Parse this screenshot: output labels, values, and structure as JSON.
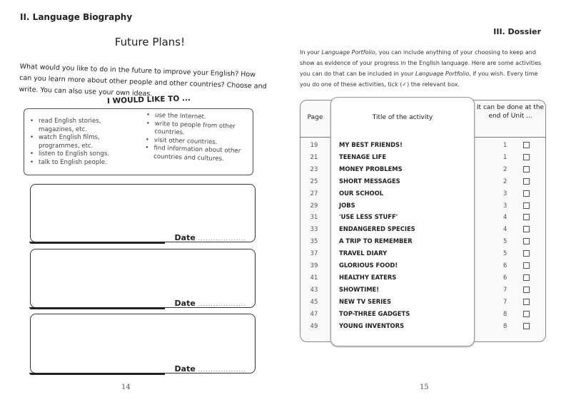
{
  "left_page": {
    "section": "II. Language Biography",
    "title": "Future Plans!",
    "intro": "What would you like to do in the future to improve your English? How can you learn more about other people and other countries? Choose and write. You can also use your own ideas.",
    "subheading": "I WOULD LIKE TO ...",
    "ideas_col1": [
      "read English stories, magazines, etc.",
      "watch English films, programmes, etc.",
      "listen to English songs.",
      "talk to English people."
    ],
    "ideas_col2": [
      "use the Internet.",
      "write to people from other countries.",
      "visit other countries.",
      "find information about other countries and cultures."
    ],
    "date_label": "Date",
    "date_dots": "...................",
    "page_number": "14"
  },
  "right_page": {
    "section": "III. Dossier",
    "intro_parts": [
      "In your ",
      "Language Portfolio",
      ", you can include anything of your choosing to keep and show as evidence of your progress in the English language. Here are some activities you can do that can be included in your ",
      "Language Portfolio",
      ", if you wish. Every time you do one of these activities, tick (✓) the relevant box."
    ],
    "table": {
      "headers": {
        "page": "Page",
        "title": "Title of the activity",
        "unit": "It can be done at the end of Unit ..."
      },
      "rows": [
        {
          "page": "19",
          "title": "MY BEST FRIENDS!",
          "unit": "1"
        },
        {
          "page": "21",
          "title": "TEENAGE LIFE",
          "unit": "1"
        },
        {
          "page": "23",
          "title": "MONEY PROBLEMS",
          "unit": "2"
        },
        {
          "page": "25",
          "title": "SHORT MESSAGES",
          "unit": "2"
        },
        {
          "page": "27",
          "title": "OUR SCHOOL",
          "unit": "3"
        },
        {
          "page": "29",
          "title": "JOBS",
          "unit": "3"
        },
        {
          "page": "31",
          "title": "'USE LESS STUFF'",
          "unit": "4"
        },
        {
          "page": "33",
          "title": "ENDANGERED SPECIES",
          "unit": "4"
        },
        {
          "page": "35",
          "title": "A TRIP TO REMEMBER",
          "unit": "5"
        },
        {
          "page": "37",
          "title": "TRAVEL DIARY",
          "unit": "5"
        },
        {
          "page": "39",
          "title": "GLORIOUS FOOD!",
          "unit": "6"
        },
        {
          "page": "41",
          "title": "HEALTHY EATERS",
          "unit": "6"
        },
        {
          "page": "43",
          "title": "SHOWTIME!",
          "unit": "7"
        },
        {
          "page": "45",
          "title": "NEW TV SERIES",
          "unit": "7"
        },
        {
          "page": "47",
          "title": "TOP-THREE GADGETS",
          "unit": "8"
        },
        {
          "page": "49",
          "title": "YOUNG INVENTORS",
          "unit": "8"
        }
      ]
    },
    "page_number": "15"
  }
}
